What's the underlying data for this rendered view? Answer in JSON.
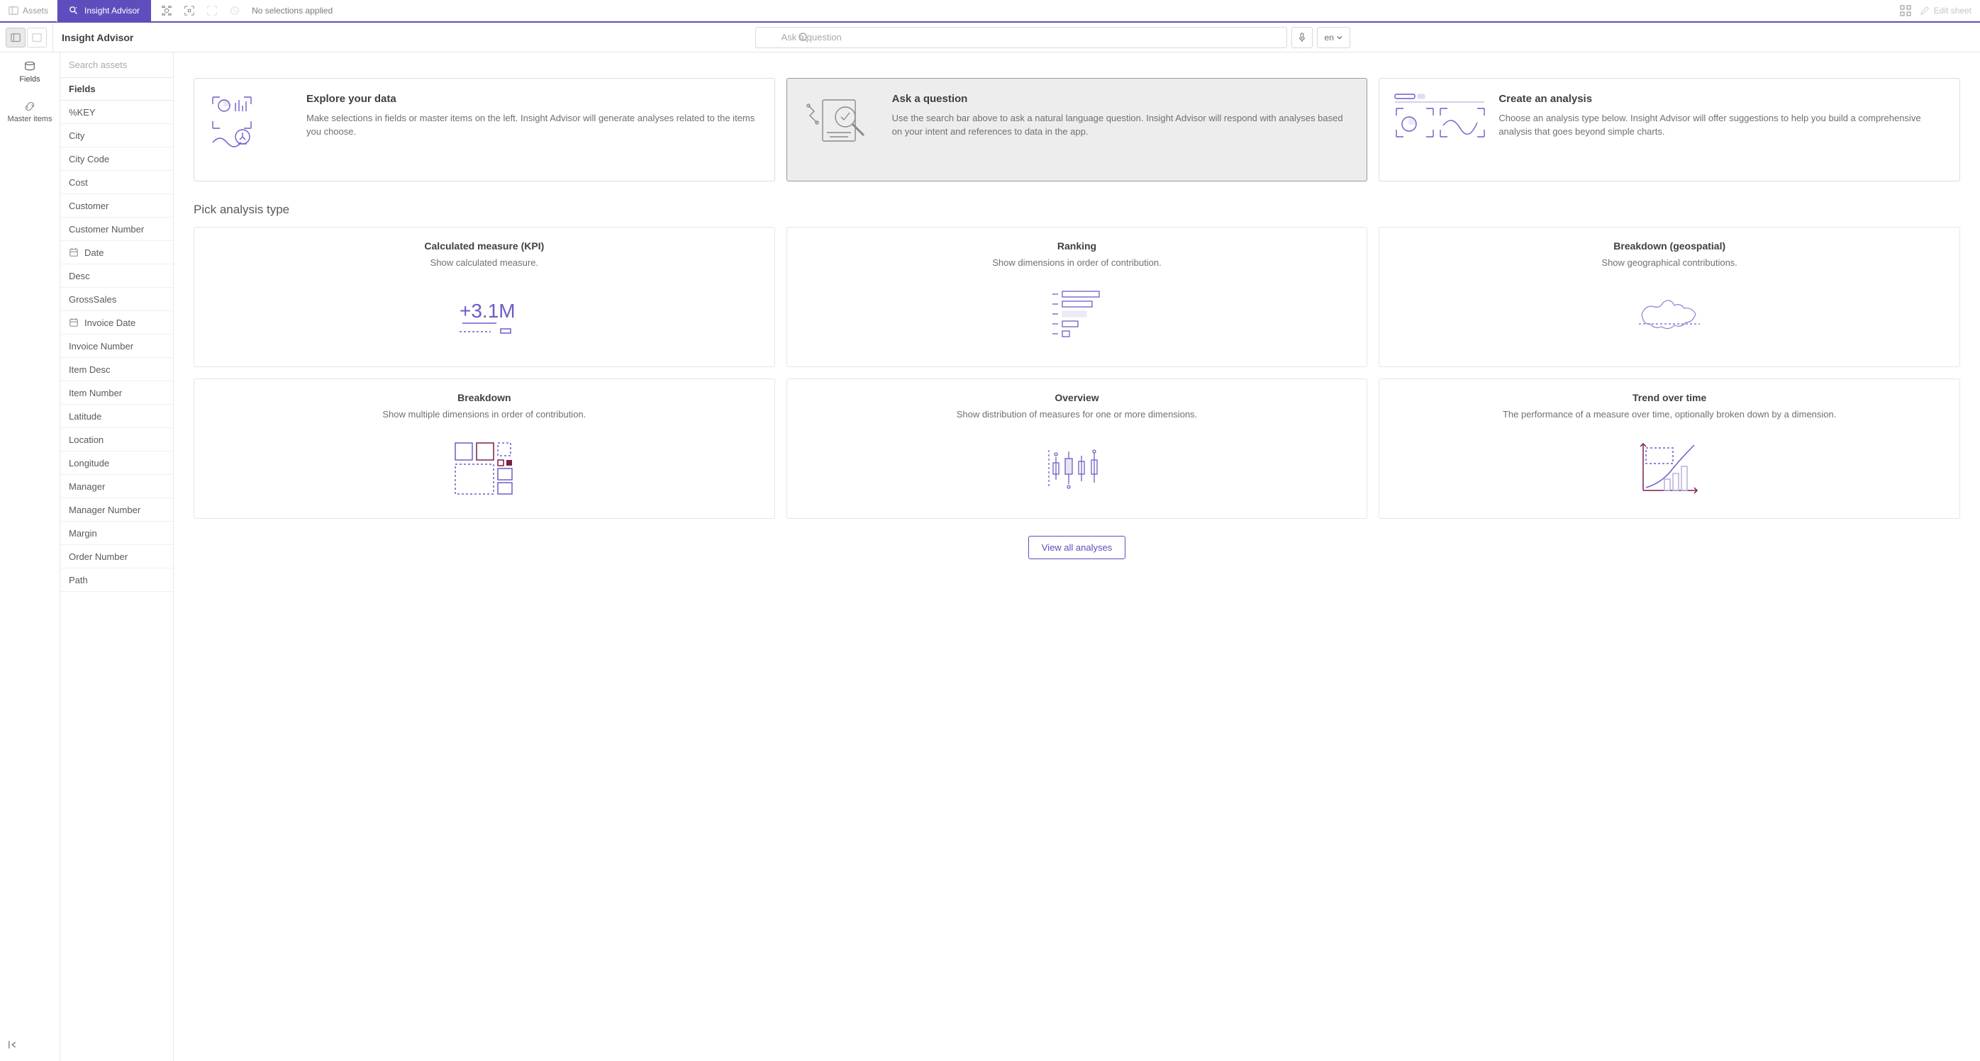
{
  "top": {
    "assets_label": "Assets",
    "tab_label": "Insight Advisor",
    "no_selections": "No selections applied",
    "edit_sheet": "Edit sheet"
  },
  "sub": {
    "title": "Insight Advisor",
    "search_placeholder": "Ask a question",
    "lang": "en"
  },
  "rail": {
    "fields": "Fields",
    "master": "Master items"
  },
  "side": {
    "search_placeholder": "Search assets",
    "header": "Fields",
    "items": [
      {
        "label": "%KEY"
      },
      {
        "label": "City"
      },
      {
        "label": "City Code"
      },
      {
        "label": "Cost"
      },
      {
        "label": "Customer"
      },
      {
        "label": "Customer Number"
      },
      {
        "label": "Date",
        "date": true
      },
      {
        "label": "Desc"
      },
      {
        "label": "GrossSales"
      },
      {
        "label": "Invoice Date",
        "date": true
      },
      {
        "label": "Invoice Number"
      },
      {
        "label": "Item Desc"
      },
      {
        "label": "Item Number"
      },
      {
        "label": "Latitude"
      },
      {
        "label": "Location"
      },
      {
        "label": "Longitude"
      },
      {
        "label": "Manager"
      },
      {
        "label": "Manager Number"
      },
      {
        "label": "Margin"
      },
      {
        "label": "Order Number"
      },
      {
        "label": "Path"
      }
    ]
  },
  "intro": {
    "explore": {
      "title": "Explore your data",
      "desc": "Make selections in fields or master items on the left. Insight Advisor will generate analyses related to the items you choose."
    },
    "ask": {
      "title": "Ask a question",
      "desc": "Use the search bar above to ask a natural language question. Insight Advisor will respond with analyses based on your intent and references to data in the app."
    },
    "create": {
      "title": "Create an analysis",
      "desc": "Choose an analysis type below. Insight Advisor will offer suggestions to help you build a comprehensive analysis that goes beyond simple charts."
    }
  },
  "section_title": "Pick analysis type",
  "analysis": [
    {
      "title": "Calculated measure (KPI)",
      "desc": "Show calculated measure.",
      "viz": "kpi"
    },
    {
      "title": "Ranking",
      "desc": "Show dimensions in order of contribution.",
      "viz": "ranking"
    },
    {
      "title": "Breakdown (geospatial)",
      "desc": "Show geographical contributions.",
      "viz": "geo"
    },
    {
      "title": "Breakdown",
      "desc": "Show multiple dimensions in order of contribution.",
      "viz": "treemap"
    },
    {
      "title": "Overview",
      "desc": "Show distribution of measures for one or more dimensions.",
      "viz": "box"
    },
    {
      "title": "Trend over time",
      "desc": "The performance of a measure over time, optionally broken down by a dimension.",
      "viz": "trend"
    }
  ],
  "view_all": "View all analyses"
}
